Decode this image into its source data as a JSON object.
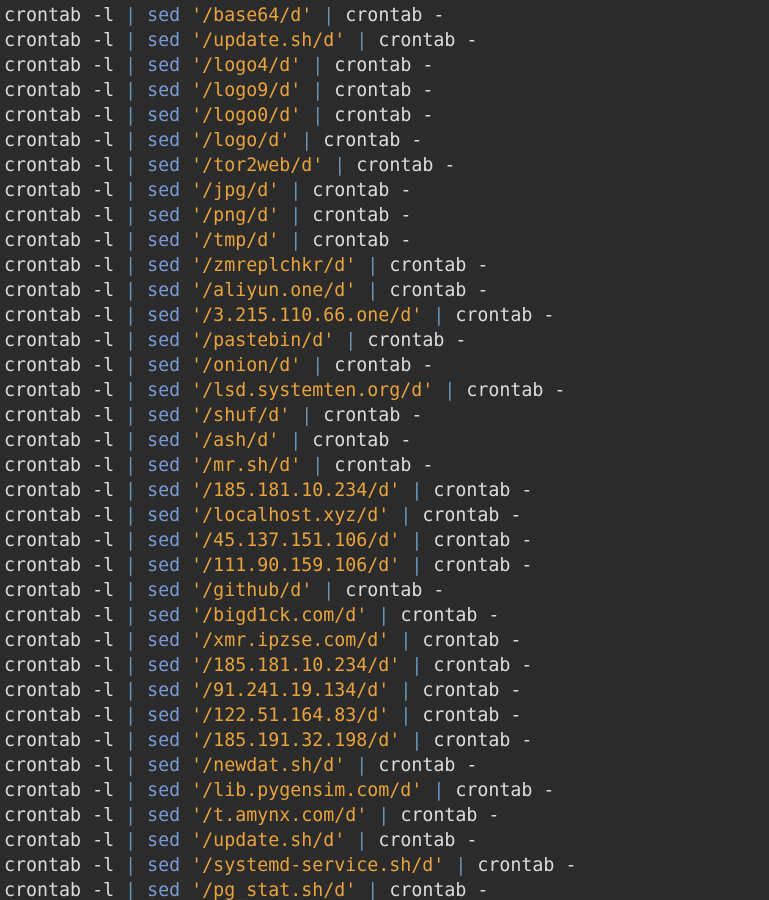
{
  "editor": {
    "colors": {
      "background": "#2b2b2b",
      "command": "#dcdcdc",
      "pipe": "#6897bb",
      "sed_keyword": "#7a9bd8",
      "string": "#e8a33d"
    },
    "tokens": {
      "cmd": "crontab",
      "flag": "-l",
      "pipe": "|",
      "sed": "sed",
      "stdin": "-"
    },
    "lines": [
      "'/base64/d'",
      "'/update.sh/d'",
      "'/logo4/d'",
      "'/logo9/d'",
      "'/logo0/d'",
      "'/logo/d'",
      "'/tor2web/d'",
      "'/jpg/d'",
      "'/png/d'",
      "'/tmp/d'",
      "'/zmreplchkr/d'",
      "'/aliyun.one/d'",
      "'/3.215.110.66.one/d'",
      "'/pastebin/d'",
      "'/onion/d'",
      "'/lsd.systemten.org/d'",
      "'/shuf/d'",
      "'/ash/d'",
      "'/mr.sh/d'",
      "'/185.181.10.234/d'",
      "'/localhost.xyz/d'",
      "'/45.137.151.106/d'",
      "'/111.90.159.106/d'",
      "'/github/d'",
      "'/bigd1ck.com/d'",
      "'/xmr.ipzse.com/d'",
      "'/185.181.10.234/d'",
      "'/91.241.19.134/d'",
      "'/122.51.164.83/d'",
      "'/185.191.32.198/d'",
      "'/newdat.sh/d'",
      "'/lib.pygensim.com/d'",
      "'/t.amynx.com/d'",
      "'/update.sh/d'",
      "'/systemd-service.sh/d'",
      "'/pg_stat.sh/d'"
    ]
  }
}
